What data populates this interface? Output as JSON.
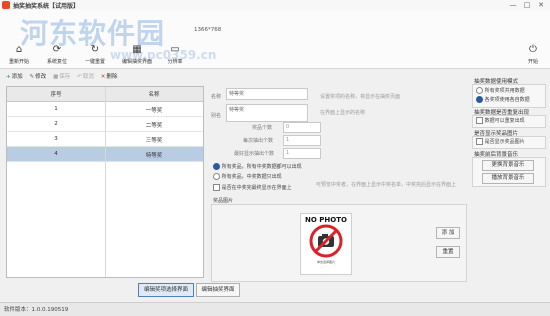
{
  "window": {
    "title": "抽奖抽奖系统【试用版】",
    "min": "—",
    "max": "□",
    "close": "✕"
  },
  "watermark": {
    "text": "河东软件园",
    "url": "www.pc0359.cn"
  },
  "toolbar": {
    "items": [
      {
        "label": "重新开始",
        "icon": "home-icon",
        "glyph": "⌂"
      },
      {
        "label": "系统复位",
        "icon": "reset-icon",
        "glyph": "⟳"
      },
      {
        "label": "一键重置",
        "icon": "refresh-icon",
        "glyph": "↻"
      },
      {
        "label": "编辑抽奖界面",
        "icon": "edit-screen-icon",
        "glyph": "▦"
      },
      {
        "label": "分辨率",
        "icon": "display-icon",
        "glyph": "▭"
      }
    ],
    "resolution": "1366*768",
    "start": {
      "label": "开始",
      "icon": "power-icon",
      "glyph": "⏻"
    }
  },
  "actions": [
    {
      "label": "添加",
      "glyph": "+"
    },
    {
      "label": "修改",
      "glyph": "✎"
    },
    {
      "label": "保存",
      "glyph": "■"
    },
    {
      "label": "取消",
      "glyph": "↶"
    },
    {
      "label": "删除",
      "glyph": "✕"
    }
  ],
  "grid": {
    "columns": [
      "序号",
      "名称"
    ],
    "rows": [
      [
        "1",
        "一等奖"
      ],
      [
        "2",
        "二等奖"
      ],
      [
        "3",
        "三等奖"
      ],
      [
        "4",
        "特等奖"
      ]
    ],
    "selected": 3
  },
  "form": {
    "name_label": "名称",
    "name_value": "特等奖",
    "name_note": "设置奖项的名称，将显示在抽奖页面",
    "alias_label": "别名",
    "alias_value": "特等奖",
    "alias_note": "在界面上显示的名称",
    "count_label": "奖品个数",
    "count_value": "0",
    "per_draw_label": "每次抽出个数",
    "per_draw_value": "1",
    "show_label": "最好显示抽出个数",
    "show_value": "1",
    "radio1": "所有奖品，所有中奖数据都可以出现",
    "radio2": "所有奖品，中奖数据只出现",
    "check1": "是否在中奖完最终显示在界面上",
    "check1_note": "可预览中奖者，在界面上显示中奖名单，中奖完后显示在界面上",
    "image_label": "奖品图片"
  },
  "image": {
    "placeholder": "NO PHOTO",
    "caption": "单击选择图片",
    "add_label": "添 加",
    "clear_label": "重置"
  },
  "right": {
    "data_mode": {
      "title": "抽奖数据使用模式",
      "options": [
        "所有奖项共用数据",
        "各奖项使用各自数据"
      ],
      "selected": 1
    },
    "repeat": {
      "title": "抽奖数据是否重复出现",
      "option": "数据可以重复出现"
    },
    "show_img": {
      "title": "是否显示奖品图片",
      "option": "是否显示奖品图片"
    },
    "music": {
      "title": "抽奖前后背景音乐",
      "btn1": "更换背景音乐",
      "btn2": "播放背景音乐"
    }
  },
  "bottom_buttons": {
    "edit_awards": "编辑奖项选择界面",
    "edit_interface": "编辑抽奖界面"
  },
  "status": {
    "version": "软件版本：1.0.0.190519"
  }
}
